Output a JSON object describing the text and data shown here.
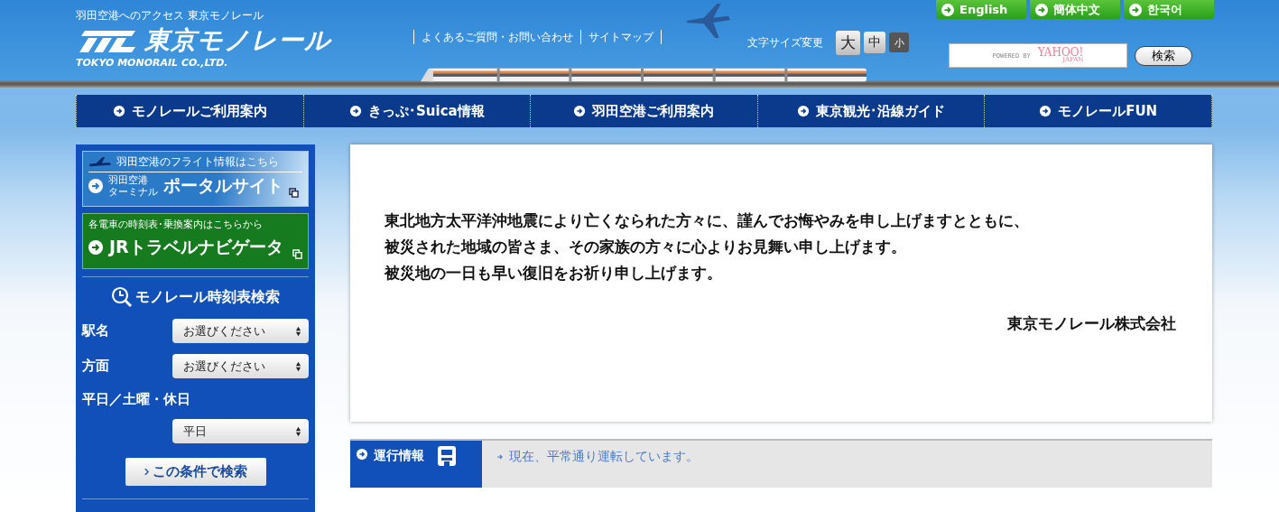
{
  "header": {
    "tagline": "羽田空港へのアクセス 東京モノレール",
    "logo": "東京モノレール",
    "logo_sub": "TOKYO MONORAIL CO.,LTD.",
    "links": [
      "よくあるご質問・お問い合わせ",
      "サイトマップ"
    ],
    "font_size": {
      "label": "文字サイズ変更",
      "options": [
        {
          "label": "大",
          "selected": false
        },
        {
          "label": "中",
          "selected": false
        },
        {
          "label": "小",
          "selected": true
        }
      ]
    },
    "languages": [
      "English",
      "簡体中文",
      "한국어"
    ],
    "search": {
      "powered_by": "POWERED BY",
      "provider": "YAHOO!",
      "provider_sub": "JAPAN",
      "button": "検索"
    }
  },
  "nav": [
    "モノレールご利用案内",
    "きっぷ･Suica情報",
    "羽田空港ご利用案内",
    "東京観光･沿線ガイド",
    "モノレールFUN"
  ],
  "sidebar": {
    "flight_banner": {
      "heading": "羽田空港のフライト情報はこちら",
      "small": [
        "羽田空港",
        "ターミナル"
      ],
      "title": "ポータルサイト"
    },
    "jr_banner": {
      "heading": "各電車の時刻表･乗換案内はこちらから",
      "title": "JRトラベルナビゲータ"
    },
    "timetable": {
      "title": "モノレール時刻表検索",
      "fields": [
        {
          "kind": "inline",
          "label": "駅名",
          "value": "お選びください"
        },
        {
          "kind": "inline",
          "label": "方面",
          "value": "お選びください"
        },
        {
          "kind": "stacked",
          "label": "平日／土曜・休日",
          "value": "平日"
        }
      ],
      "button": "この条件で検索"
    }
  },
  "message": {
    "lines": [
      "東北地方太平洋沖地震により亡くなられた方々に、謹んでお悔やみを申し上げますとともに、",
      "被災された地域の皆さま、その家族の方々に心よりお見舞い申し上げます。",
      "被災地の一日も早い復旧をお祈り申し上げます。"
    ],
    "signature": "東京モノレール株式会社"
  },
  "status": {
    "label": "運行情報",
    "text": "現在、平常通り運転しています。"
  }
}
